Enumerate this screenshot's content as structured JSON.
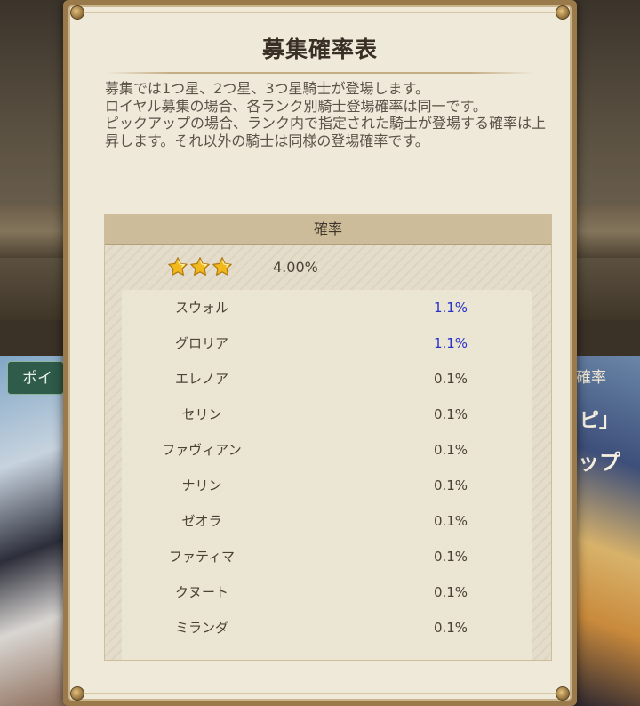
{
  "dialog": {
    "title": "募集確率表",
    "description": [
      "募集では1つ星、2つ星、3つ星騎士が登場します。",
      "ロイヤル募集の場合、各ランク別騎士登場確率は同一です。",
      "ピックアップの場合、ランク内で指定された騎士が登場する確率は上昇します。それ以外の騎士は同様の登場確率です。"
    ]
  },
  "table": {
    "header": "確率",
    "rank": {
      "stars": 3,
      "rate": "4.00%"
    },
    "rows": [
      {
        "name": "スウォル",
        "rate": "1.1%",
        "highlight": true
      },
      {
        "name": "グロリア",
        "rate": "1.1%",
        "highlight": true
      },
      {
        "name": "エレノア",
        "rate": "0.1%",
        "highlight": false
      },
      {
        "name": "セリン",
        "rate": "0.1%",
        "highlight": false
      },
      {
        "name": "ファヴィアン",
        "rate": "0.1%",
        "highlight": false
      },
      {
        "name": "ナリン",
        "rate": "0.1%",
        "highlight": false
      },
      {
        "name": "ゼオラ",
        "rate": "0.1%",
        "highlight": false
      },
      {
        "name": "ファティマ",
        "rate": "0.1%",
        "highlight": false
      },
      {
        "name": "クヌート",
        "rate": "0.1%",
        "highlight": false
      },
      {
        "name": "ミランダ",
        "rate": "0.1%",
        "highlight": false
      }
    ]
  },
  "background": {
    "left_button": "ポイ",
    "right_label": "確率",
    "right_text_1": "ピ」",
    "right_text_2": "ップ"
  },
  "colors": {
    "highlight_rate": "#2a33c8",
    "star": "#f2b91c"
  }
}
